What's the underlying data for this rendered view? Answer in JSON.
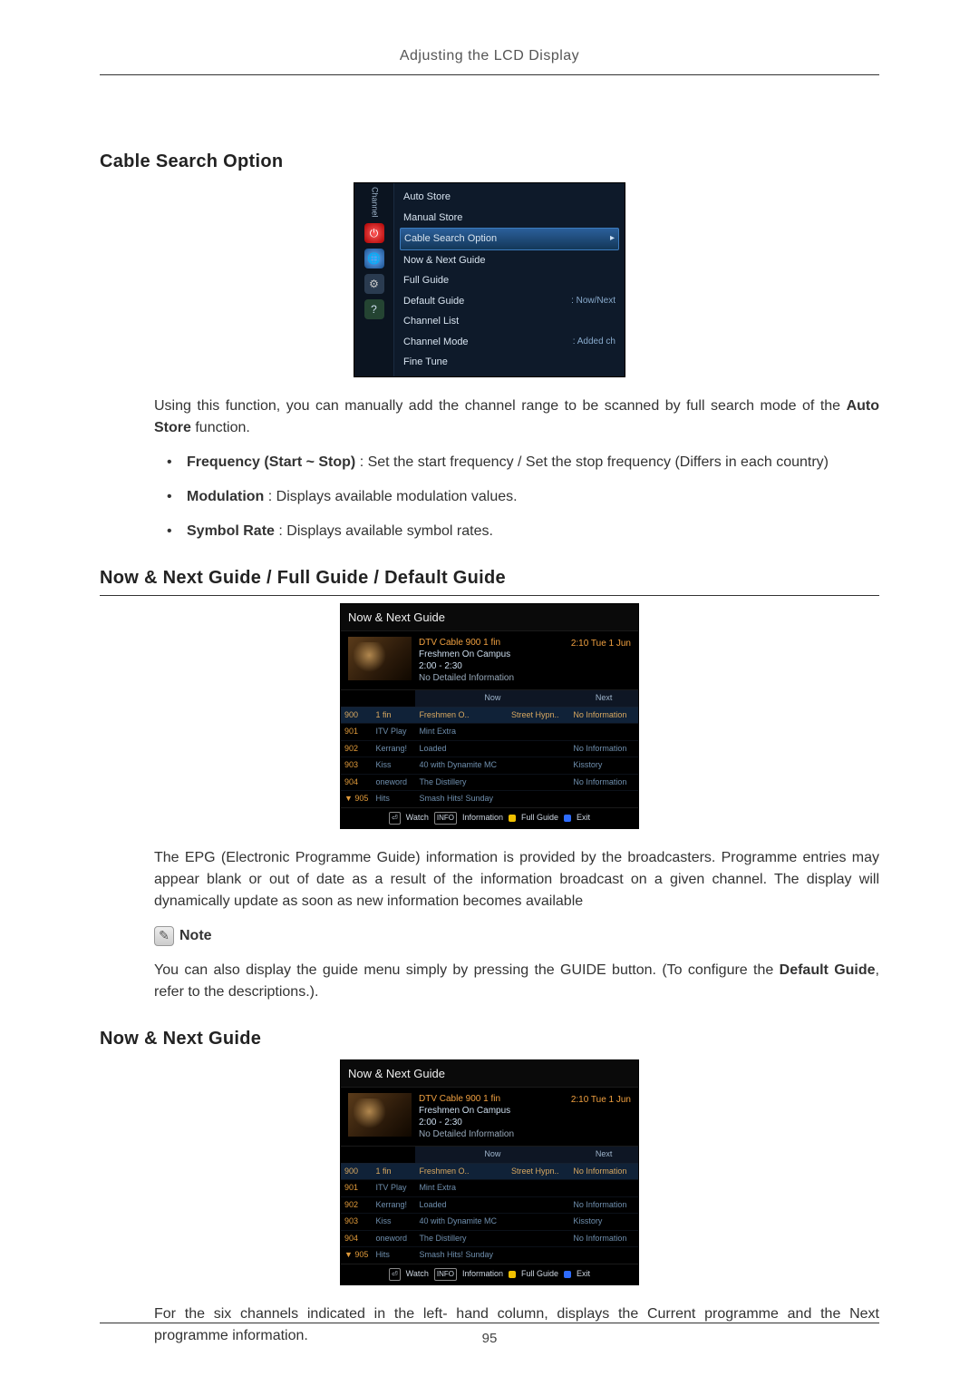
{
  "header": {
    "title": "Adjusting the LCD Display"
  },
  "footer": {
    "page_number": "95"
  },
  "sections": {
    "cable": {
      "heading": "Cable Search Option",
      "intro_pre": "Using this function, you can manually add the channel range to be scanned by full search mode of the ",
      "intro_bold": "Auto Store",
      "intro_post": " function.",
      "bullets": {
        "freq_label": "Frequency (Start ~ Stop)",
        "freq_text": " : Set the start frequency / Set the stop frequency (Differs in each country)",
        "mod_label": "Modulation",
        "mod_text": " : Displays available modulation values.",
        "sym_label": "Symbol Rate",
        "sym_text": " : Displays available symbol rates."
      }
    },
    "guide": {
      "heading": "Now & Next Guide / Full Guide / Default Guide",
      "para1": "The EPG (Electronic Programme Guide) information is provided by the broadcasters. Programme entries may appear blank or out of date as a result of the information broadcast on a given channel. The display will dynamically update as soon as new information becomes available",
      "note_label": "Note",
      "para2_pre": "You can also display the guide menu simply by pressing the GUIDE button. (To configure the ",
      "para2_bold": "Default Guide",
      "para2_post": ", refer to the descriptions.)."
    },
    "nownext": {
      "heading": "Now & Next Guide",
      "para": "For the six channels indicated in the left- hand column, displays the Current programme and the Next programme information."
    }
  },
  "osd_channel": {
    "side_label": "Channel",
    "items": {
      "auto_store": "Auto Store",
      "manual_store": "Manual Store",
      "cable_search": "Cable Search Option",
      "now_next": "Now & Next Guide",
      "full_guide": "Full Guide",
      "default_guide": "Default Guide",
      "default_guide_val": ": Now/Next",
      "channel_list": "Channel List",
      "channel_mode": "Channel Mode",
      "channel_mode_val": ": Added ch",
      "fine_tune": "Fine Tune"
    }
  },
  "osd_guide": {
    "title": "Now & Next Guide",
    "head": {
      "channel": "DTV Cable 900 1 fin",
      "program": "Freshmen On Campus",
      "time": "2:00 - 2:30",
      "detail": "No Detailed Information",
      "date": "2:10 Tue 1 Jun"
    },
    "cols": {
      "now": "Now",
      "next": "Next"
    },
    "rows": [
      {
        "num": "900",
        "name": "1 fin",
        "now": "Freshmen O..",
        "now2": "Street Hypn..",
        "next": "No Information"
      },
      {
        "num": "901",
        "name": "ITV Play",
        "now": "Mint Extra",
        "now2": "",
        "next": ""
      },
      {
        "num": "902",
        "name": "Kerrang!",
        "now": "Loaded",
        "now2": "",
        "next": "No Information"
      },
      {
        "num": "903",
        "name": "Kiss",
        "now": "40 with Dynamite MC",
        "now2": "",
        "next": "Kisstory"
      },
      {
        "num": "904",
        "name": "oneword",
        "now": "The Distillery",
        "now2": "",
        "next": "No Information"
      },
      {
        "num": "905",
        "name": "Hits",
        "now": "Smash Hits! Sunday",
        "now2": "",
        "next": ""
      }
    ],
    "foot": {
      "watch": "Watch",
      "info_chip": "INFO",
      "info": "Information",
      "full": "Full Guide",
      "exit": "Exit"
    }
  }
}
